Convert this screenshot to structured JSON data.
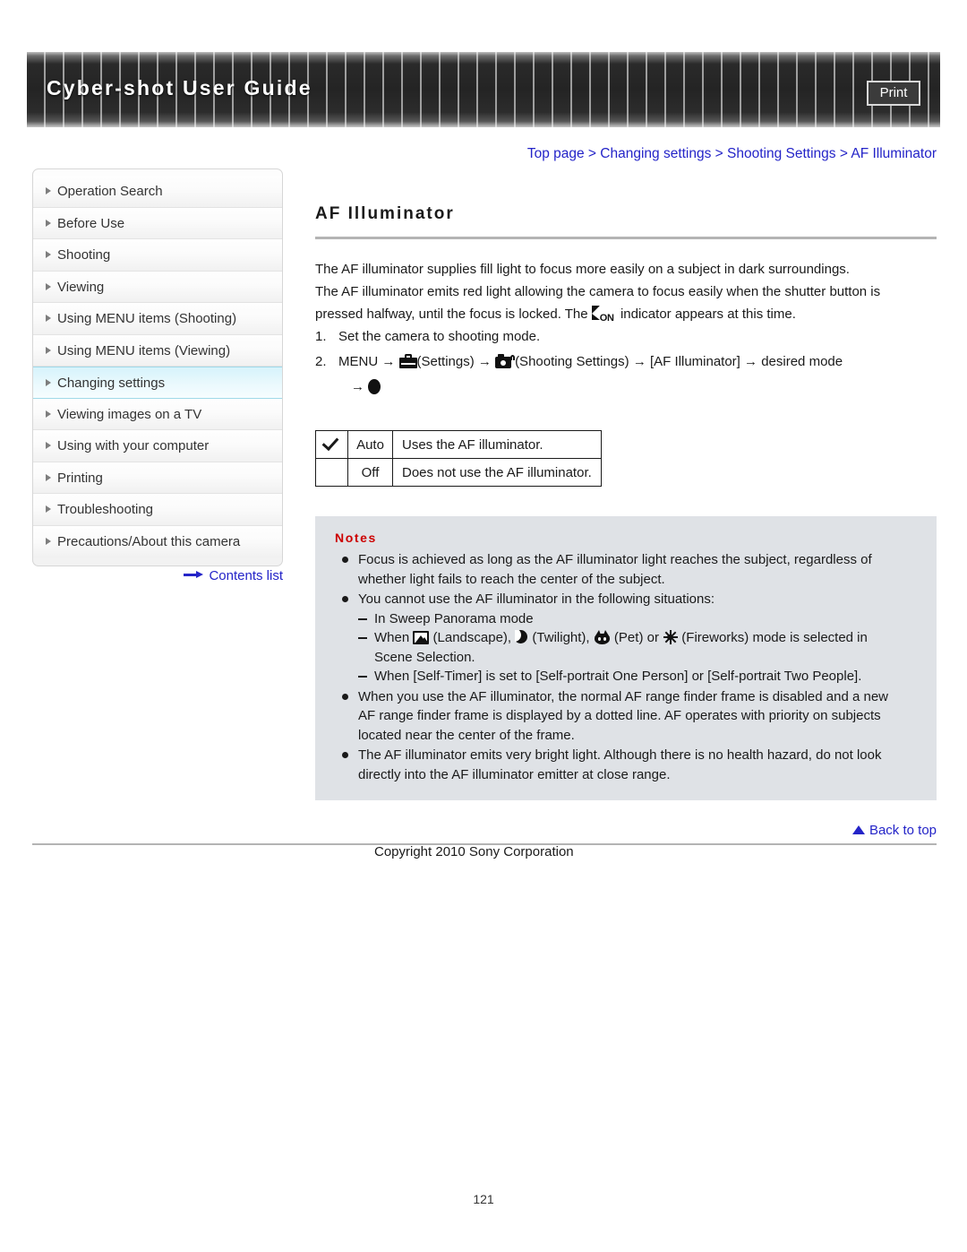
{
  "header": {
    "title": "Cyber-shot User Guide",
    "print_label": "Print"
  },
  "sidebar": {
    "items": [
      {
        "label": "Operation Search",
        "active": false
      },
      {
        "label": "Before Use",
        "active": false
      },
      {
        "label": "Shooting",
        "active": false
      },
      {
        "label": "Viewing",
        "active": false
      },
      {
        "label": "Using MENU items (Shooting)",
        "active": false
      },
      {
        "label": "Using MENU items (Viewing)",
        "active": false
      },
      {
        "label": "Changing settings",
        "active": true
      },
      {
        "label": "Viewing images on a TV",
        "active": false
      },
      {
        "label": "Using with your computer",
        "active": false
      },
      {
        "label": "Printing",
        "active": false
      },
      {
        "label": "Troubleshooting",
        "active": false
      },
      {
        "label": "Precautions/About this camera",
        "active": false
      }
    ],
    "contents_link": "Contents list"
  },
  "breadcrumb": {
    "items": [
      "Top page",
      "Changing settings",
      "Shooting Settings",
      "AF Illuminator"
    ],
    "separator": ">"
  },
  "main": {
    "title": "AF Illuminator",
    "intro_line1": "The AF illuminator supplies fill light to focus more easily on a subject in dark surroundings.",
    "intro_line2": "The AF illuminator emits red light allowing the camera to focus easily when the shutter button is",
    "intro_line3_pre": "pressed halfway, until the focus is locked. The",
    "intro_line3_post": "indicator appears at this time.",
    "steps": [
      {
        "num": "1.",
        "text": "Set the camera to shooting mode."
      }
    ],
    "step2": {
      "num": "2.",
      "t1": "MENU",
      "arrow": "→",
      "t2": "(Settings)",
      "t3": "(Shooting Settings)",
      "t4": "[AF Illuminator]",
      "t5": "desired mode"
    },
    "table": {
      "rows": [
        {
          "default": true,
          "name": "Auto",
          "desc": "Uses the AF illuminator."
        },
        {
          "default": false,
          "name": "Off",
          "desc": "Does not use the AF illuminator."
        }
      ]
    },
    "notes": {
      "title": "Notes",
      "items": [
        {
          "type": "bullet",
          "lines": [
            "Focus is achieved as long as the AF illuminator light reaches the subject, regardless of",
            "whether light fails to reach the center of the subject."
          ]
        },
        {
          "type": "bullet",
          "lines": [
            "You cannot use the AF illuminator in the following situations:"
          ]
        },
        {
          "type": "dash",
          "lines": [
            "In Sweep Panorama mode"
          ]
        },
        {
          "type": "dash-icons",
          "pre": "When",
          "seg1": "(Landscape),",
          "seg2": "(Twilight),",
          "seg3": "(Pet) or",
          "seg4": "(Fireworks) mode is selected in",
          "cont": "Scene Selection."
        },
        {
          "type": "dash",
          "lines": [
            "When [Self-Timer] is set to [Self-portrait One Person] or [Self-portrait Two People]."
          ]
        },
        {
          "type": "bullet",
          "lines": [
            "When you use the AF illuminator, the normal AF range finder frame is disabled and a new",
            "AF range finder frame is displayed by a dotted line. AF operates with priority on subjects",
            "located near the center of the frame."
          ]
        },
        {
          "type": "bullet",
          "lines": [
            "The AF illuminator emits very bright light. Although there is no health hazard, do not look",
            "directly into the AF illuminator emitter at close range."
          ]
        }
      ]
    }
  },
  "footer": {
    "back_to_top": "Back to top",
    "copyright": "Copyright 2010 Sony Corporation",
    "page_number": "121"
  },
  "colors": {
    "link": "#2424c8",
    "notes_title": "#cc0000",
    "notes_bg": "#dfe2e6",
    "active_nav": "#d6f3fb"
  }
}
